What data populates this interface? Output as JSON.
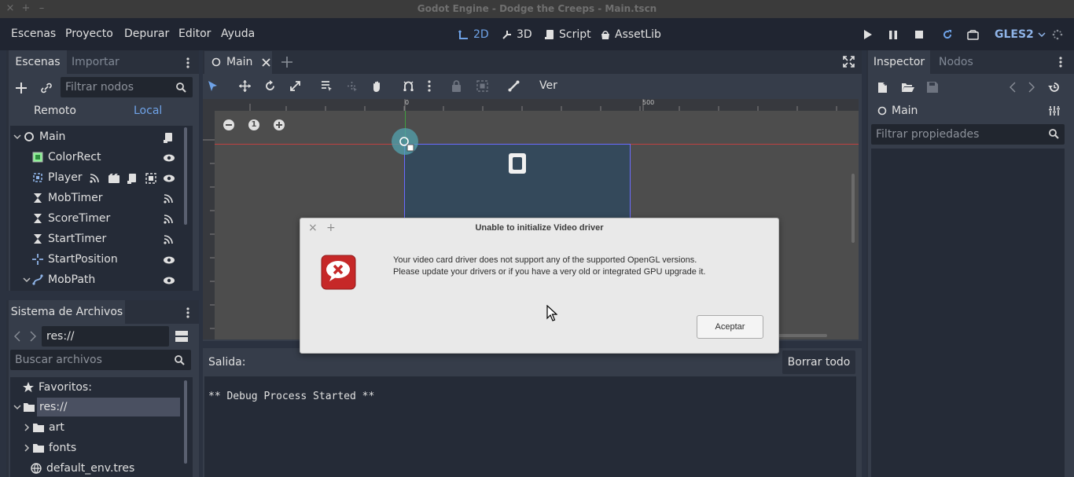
{
  "window": {
    "title": "Godot Engine - Dodge the Creeps - Main.tscn",
    "close": "×",
    "pin": "+",
    "minimize": "–"
  },
  "menu": [
    "Escenas",
    "Proyecto",
    "Depurar",
    "Editor",
    "Ayuda"
  ],
  "workspaces": {
    "w2d": "2D",
    "w3d": "3D",
    "script": "Script",
    "assetlib": "AssetLib",
    "active": "2D"
  },
  "renderer": "GLES2",
  "scene_dock": {
    "tabs": [
      "Escenas",
      "Importar"
    ],
    "filter_placeholder": "Filtrar nodos",
    "remote": "Remoto",
    "local": "Local",
    "nodes": [
      {
        "label": "Main",
        "icon": "node-circle-icon"
      },
      {
        "label": "ColorRect",
        "icon": "colorrect-icon"
      },
      {
        "label": "Player",
        "icon": "area2d-icon"
      },
      {
        "label": "MobTimer",
        "icon": "timer-icon"
      },
      {
        "label": "ScoreTimer",
        "icon": "timer-icon"
      },
      {
        "label": "StartTimer",
        "icon": "timer-icon"
      },
      {
        "label": "StartPosition",
        "icon": "position2d-icon"
      },
      {
        "label": "MobPath",
        "icon": "path2d-icon"
      }
    ]
  },
  "filesystem": {
    "title": "Sistema de Archivos",
    "path": "res://",
    "search_placeholder": "Buscar archivos",
    "items": [
      {
        "label": "Favoritos:",
        "icon": "star-icon"
      },
      {
        "label": "res://",
        "icon": "folder-icon"
      },
      {
        "label": "art",
        "icon": "folder-icon"
      },
      {
        "label": "fonts",
        "icon": "folder-icon"
      },
      {
        "label": "default_env.tres",
        "icon": "globe-icon"
      }
    ]
  },
  "editor": {
    "tab": "Main",
    "view_menu": "Ver",
    "ruler_marks": [
      "0",
      "500"
    ],
    "zoom_reset": "1"
  },
  "output": {
    "label": "Salida:",
    "clear": "Borrar todo",
    "log": "** Debug Process Started **"
  },
  "inspector": {
    "tabs": [
      "Inspector",
      "Nodos"
    ],
    "node": "Main",
    "filter_placeholder": "Filtrar propiedades"
  },
  "dialog": {
    "title": "Unable to initialize Video driver",
    "line1": "Your video card driver does not support any of the supported OpenGL versions.",
    "line2": "Please update your drivers or if you have a very old or integrated GPU upgrade it.",
    "ok": "Aceptar",
    "close": "×",
    "pin": "+"
  },
  "colors": {
    "accent": "#6fa3e8",
    "dialog_icon": "#d32f2f",
    "panel": "#363d4a",
    "background": "#202531"
  }
}
